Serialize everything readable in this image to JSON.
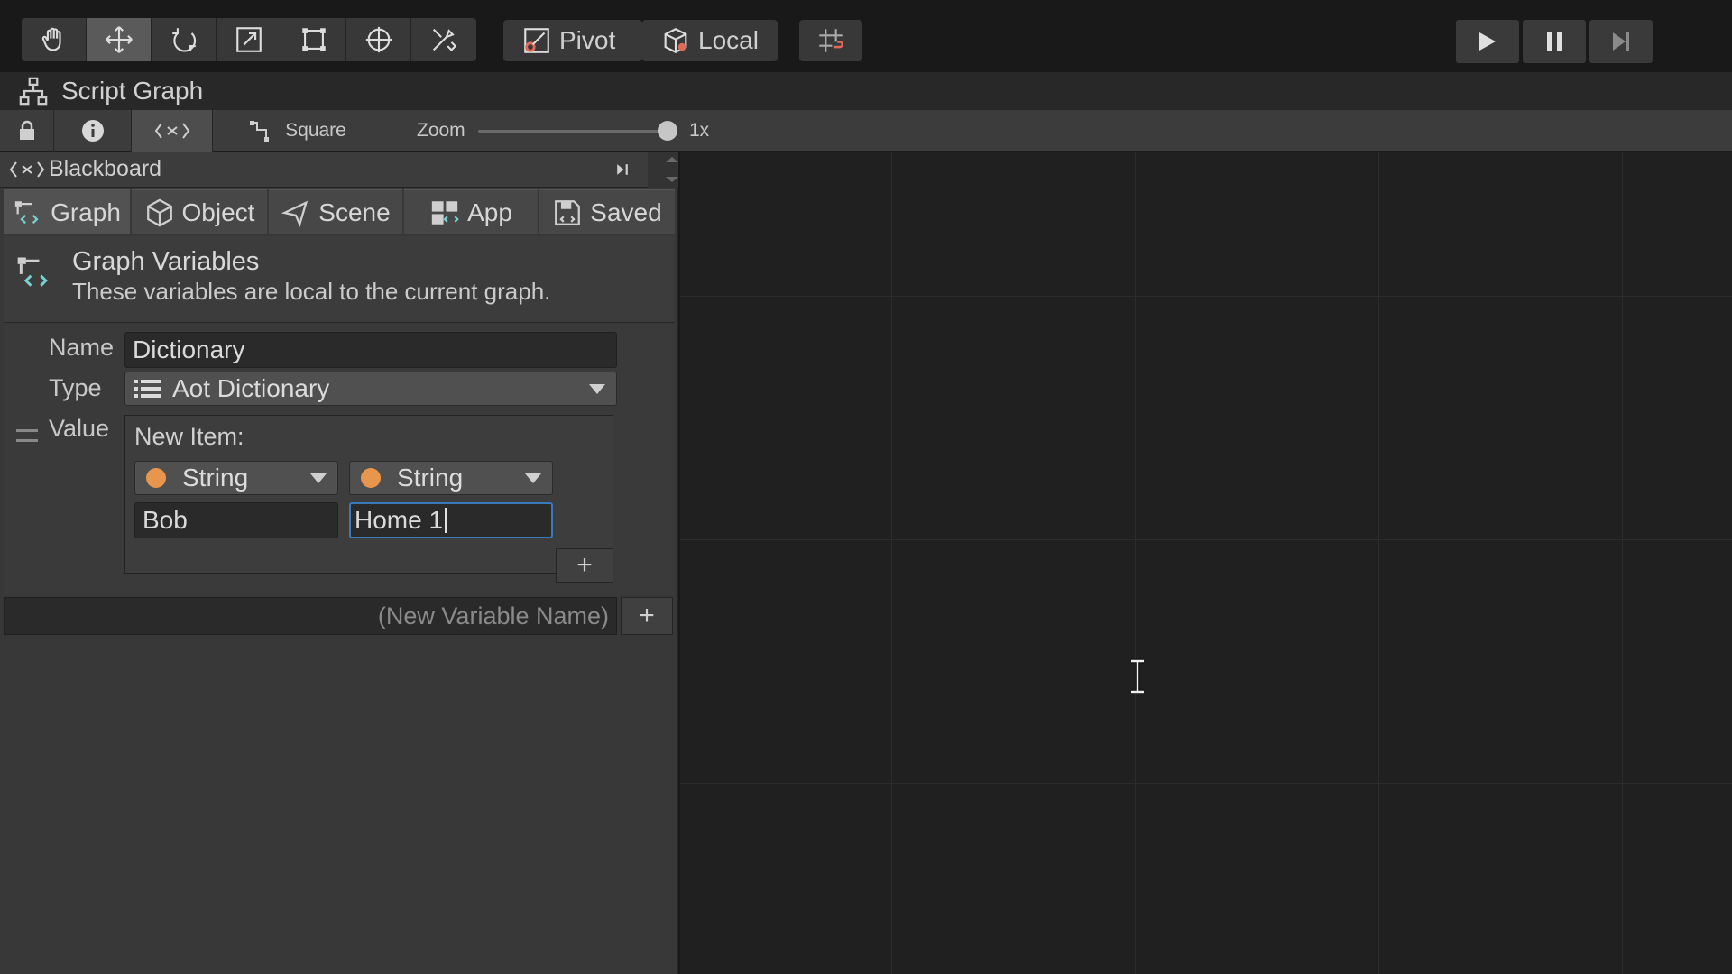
{
  "toolbar": {
    "tools": [
      "hand-tool",
      "move-tool",
      "rotate-tool",
      "scale-tool",
      "rect-tool",
      "transform-tool",
      "custom-tool"
    ],
    "pivot_label": "Pivot",
    "local_label": "Local"
  },
  "window": {
    "title": "Script Graph"
  },
  "subbar": {
    "snap_label": "Square",
    "zoom_label": "Zoom",
    "zoom_value": "1x"
  },
  "blackboard": {
    "title": "Blackboard",
    "tabs": [
      {
        "label": "Graph"
      },
      {
        "label": "Object"
      },
      {
        "label": "Scene"
      },
      {
        "label": "App"
      },
      {
        "label": "Saved"
      }
    ],
    "section_title": "Graph Variables",
    "section_subtitle": "These variables are local to the current graph.",
    "variable": {
      "name_label": "Name",
      "name_value": "Dictionary",
      "type_label": "Type",
      "type_value": "Aot Dictionary",
      "value_label": "Value",
      "new_item_label": "New Item:",
      "key_type": "String",
      "value_type": "String",
      "key_value": "Bob",
      "value_value": "Home 1"
    },
    "new_variable_placeholder": "(New Variable Name)"
  },
  "colors": {
    "accent": "#3a79bb",
    "string_dot": "#e8964e"
  }
}
